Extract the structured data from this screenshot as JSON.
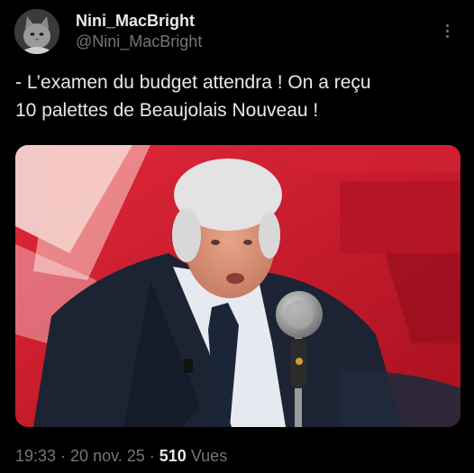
{
  "author": {
    "display_name": "Nini_MacBright",
    "handle": "@Nini_MacBright",
    "avatar_icon": "cat-avatar-icon"
  },
  "tweet": {
    "line1": "- L’examen du budget attendra ! On a reçu",
    "line2": "10 palettes de Beaujolais Nouveau !"
  },
  "meta": {
    "time": "19:33",
    "sep1": " · ",
    "date": "20 nov. 25",
    "sep2": " · ",
    "views": "510",
    "views_label": " Vues"
  },
  "icons": {
    "more": "more-options-icon"
  },
  "colors": {
    "background": "#000000",
    "text": "#e7e9ea",
    "secondary_text": "#71767b",
    "media_backdrop": "#c61a2c"
  }
}
